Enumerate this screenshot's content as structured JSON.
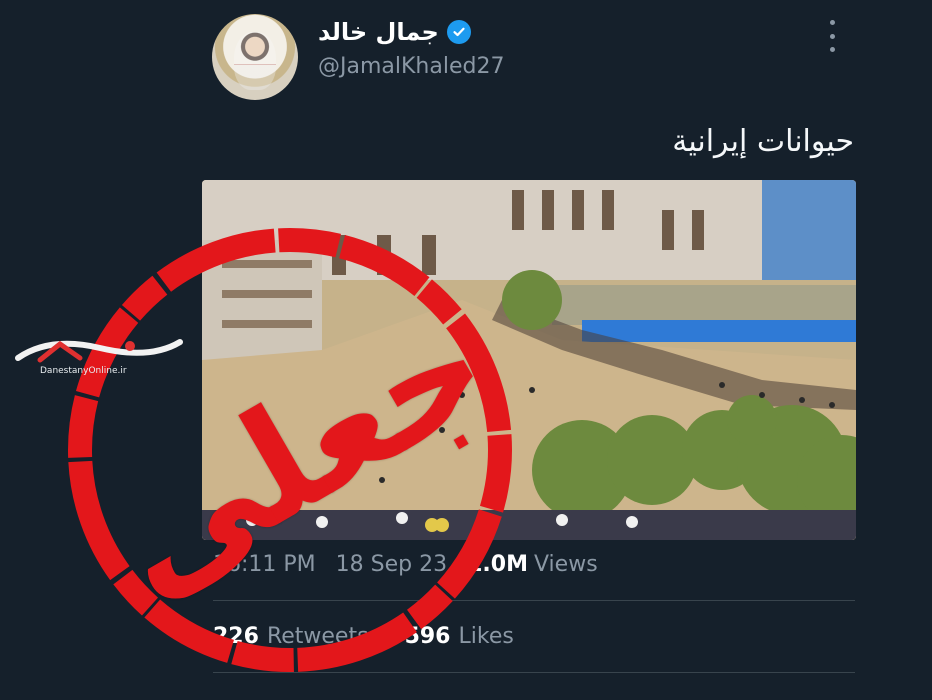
{
  "tweet": {
    "display_name": "جمال خالد",
    "handle": "@JamalKhaled27",
    "text": "حيوانات إيرانية",
    "time": "16:11 PM",
    "date": "18 Sep 23",
    "views_count": "1.0M",
    "views_label": "Views",
    "retweets_count": "226",
    "retweets_label": "Retweets",
    "likes_count": "596",
    "likes_label": "Likes"
  },
  "overlay": {
    "stamp_word": "جعلی",
    "watermark_text": "DanestanyOnline.ir"
  },
  "icons": {
    "verified": "verified-badge-icon",
    "more": "more-options-icon"
  },
  "colors": {
    "background": "#15202b",
    "verified": "#1d9bf0",
    "stamp": "#e3171b",
    "secondary_text": "#8b98a5"
  }
}
